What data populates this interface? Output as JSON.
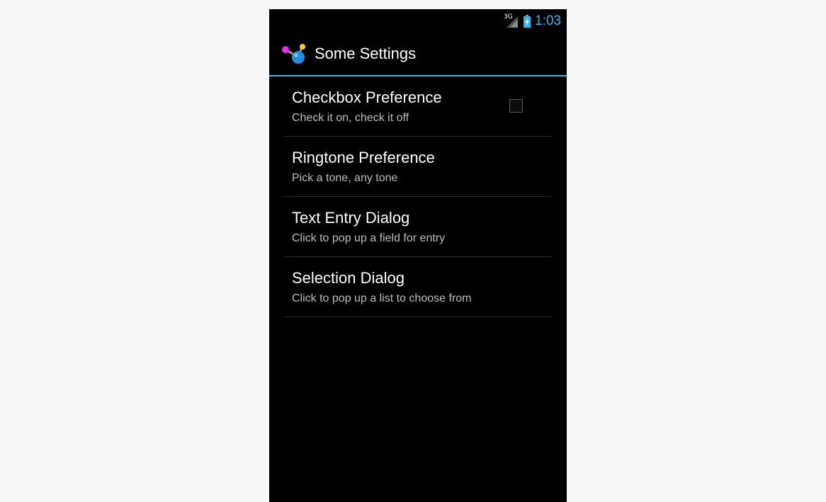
{
  "status_bar": {
    "network_label": "3G",
    "time": "1:03",
    "icons": [
      "signal-icon",
      "battery-charging-icon"
    ]
  },
  "action_bar": {
    "title": "Some Settings",
    "icon": "app-molecule-icon"
  },
  "preferences": [
    {
      "title": "Checkbox Preference",
      "summary": "Check it on, check it off",
      "type": "checkbox",
      "checked": false
    },
    {
      "title": "Ringtone Preference",
      "summary": "Pick a tone, any tone",
      "type": "ringtone"
    },
    {
      "title": "Text Entry Dialog",
      "summary": "Click to pop up a field for entry",
      "type": "edit-text"
    },
    {
      "title": "Selection Dialog",
      "summary": "Click to pop up a list to choose from",
      "type": "list"
    }
  ],
  "colors": {
    "accent": "#33b5e5",
    "background": "#000000",
    "page": "#f7f7f7",
    "title_text": "#ffffff",
    "summary_text": "#bdbdbd"
  }
}
